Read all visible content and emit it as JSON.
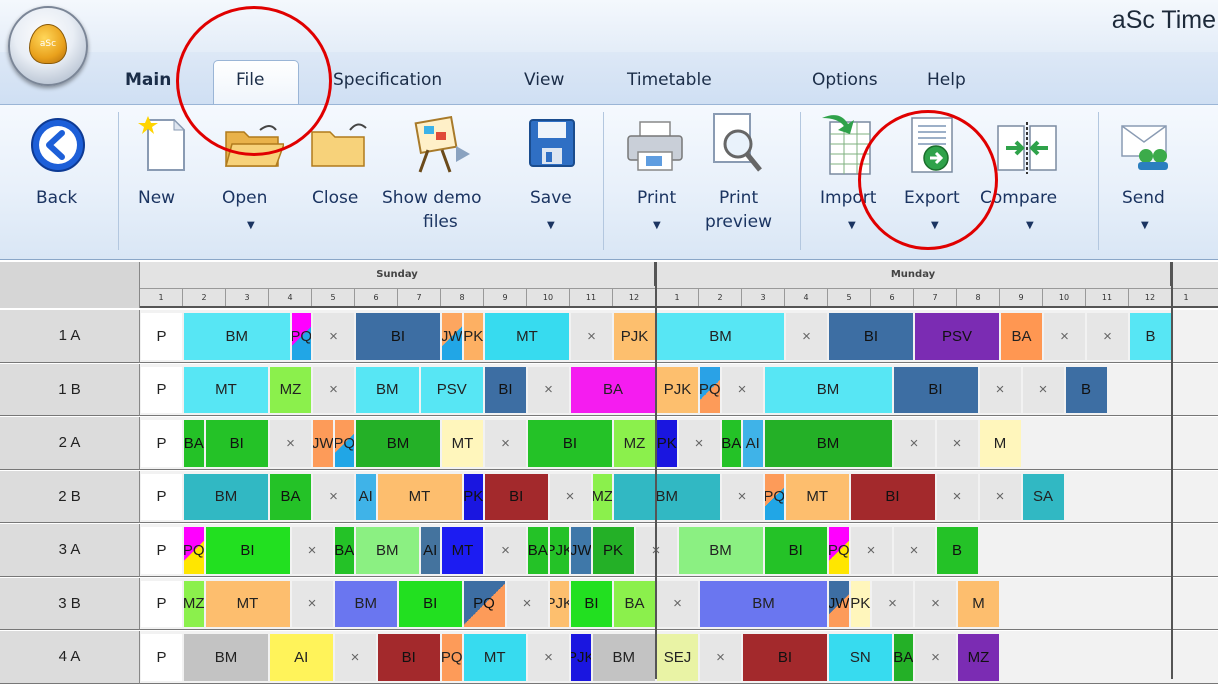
{
  "app": {
    "title": "aSc Time",
    "logo_text": "aSc"
  },
  "tabs": [
    "Main",
    "File",
    "Specification",
    "View",
    "Timetable",
    "Options",
    "Help"
  ],
  "ribbon": {
    "back": "Back",
    "new": "New",
    "open": "Open",
    "close": "Close",
    "show_demo_1": "Show demo",
    "show_demo_2": "files",
    "save": "Save",
    "print": "Print",
    "print_preview_1": "Print",
    "print_preview_2": "preview",
    "import": "Import",
    "export": "Export",
    "compare": "Compare",
    "send": "Send"
  },
  "timetable": {
    "days": [
      "Sunday",
      "Munday"
    ],
    "periods": [
      "1",
      "2",
      "3",
      "4",
      "5",
      "6",
      "7",
      "8",
      "9",
      "10",
      "11",
      "12"
    ],
    "classes": [
      "1 A",
      "1 B",
      "2 A",
      "2 B",
      "3 A",
      "3 B",
      "4 A"
    ],
    "free_mark": "×",
    "rows": [
      [
        [
          "P",
          "#ffffff",
          1
        ],
        [
          "BM",
          "#57e6f4",
          2.5
        ],
        [
          "PQ",
          "split:#ff00ff/#21a6e6",
          0.5
        ],
        [
          "×",
          "#e6e6e6",
          1
        ],
        [
          "BI",
          "#3d6ea3",
          2
        ],
        [
          "JW",
          "split:#fda660/#21a6e6",
          0.5
        ],
        [
          "PK",
          "#fdb063",
          0.5
        ],
        [
          "MT",
          "#37dbef",
          2
        ],
        [
          "×",
          "#e6e6e6",
          1
        ],
        [
          "PJK",
          "#fdbf6e",
          1
        ],
        [
          "BM",
          "#57e6f4",
          3
        ],
        [
          "×",
          "#e6e6e6",
          1
        ],
        [
          "BI",
          "#3d6ea3",
          2
        ],
        [
          "PSV",
          "#7b2cb3",
          2
        ],
        [
          "BA",
          "#ff9752",
          1
        ],
        [
          "×",
          "#e6e6e6",
          1
        ],
        [
          "×",
          "#e6e6e6",
          1
        ],
        [
          "B",
          "#57e6f4",
          1
        ]
      ],
      [
        [
          "P",
          "#ffffff",
          1
        ],
        [
          "MT",
          "#57e6f4",
          2
        ],
        [
          "MZ",
          "#8bf04c",
          1
        ],
        [
          "×",
          "#e6e6e6",
          1
        ],
        [
          "BM",
          "#57e6f4",
          1.5
        ],
        [
          "PSV",
          "#57e6f4",
          1.5
        ],
        [
          "BI",
          "#3d6ea3",
          1
        ],
        [
          "×",
          "#e6e6e6",
          1
        ],
        [
          "BA",
          "#f51cf0",
          2
        ],
        [
          "PJK",
          "#fdbf6e",
          1
        ],
        [
          "PQ",
          "split:#2aa2e6/#fd9b59",
          0.5
        ],
        [
          "×",
          "#e6e6e6",
          1
        ],
        [
          "BM",
          "#57e6f4",
          3
        ],
        [
          "BI",
          "#3d6ea3",
          2
        ],
        [
          "×",
          "#e6e6e6",
          1
        ],
        [
          "×",
          "#e6e6e6",
          1
        ],
        [
          "B",
          "#3d6ea3",
          1
        ]
      ],
      [
        [
          "P",
          "#ffffff",
          1
        ],
        [
          "BA",
          "#24c227",
          0.5
        ],
        [
          "BI",
          "#24c227",
          1.5
        ],
        [
          "×",
          "#e6e6e6",
          1
        ],
        [
          "JW",
          "#fd9b59",
          0.5
        ],
        [
          "PQ",
          "split:#fd9b59/#21a6e6",
          0.5
        ],
        [
          "BM",
          "#24b027",
          2
        ],
        [
          "MT",
          "#fff6bc",
          1
        ],
        [
          "×",
          "#e6e6e6",
          1
        ],
        [
          "BI",
          "#24c227",
          2
        ],
        [
          "MZ",
          "#8bf04c",
          1
        ],
        [
          "PK",
          "#1a16e0",
          0.5
        ],
        [
          "×",
          "#e6e6e6",
          1
        ],
        [
          "BA",
          "#24c227",
          0.5
        ],
        [
          "AI",
          "#3fb3e8",
          0.5
        ],
        [
          "BM",
          "#24b027",
          3
        ],
        [
          "×",
          "#e6e6e6",
          1
        ],
        [
          "×",
          "#e6e6e6",
          1
        ],
        [
          "M",
          "#fff6bc",
          1
        ]
      ],
      [
        [
          "P",
          "#ffffff",
          1
        ],
        [
          "BM",
          "#31b8c3",
          2
        ],
        [
          "BA",
          "#24c227",
          1
        ],
        [
          "×",
          "#e6e6e6",
          1
        ],
        [
          "AI",
          "#3fb3e8",
          0.5
        ],
        [
          "MT",
          "#fdbe6e",
          2
        ],
        [
          "PK",
          "#1a16e0",
          0.5
        ],
        [
          "BI",
          "#a3292c",
          1.5
        ],
        [
          "×",
          "#e6e6e6",
          1
        ],
        [
          "MZ",
          "#8bf04c",
          0.5
        ],
        [
          "BM",
          "#31b8c3",
          2.5
        ],
        [
          "×",
          "#e6e6e6",
          1
        ],
        [
          "PQ",
          "split:#fd9b59/#21a6e6",
          0.5
        ],
        [
          "MT",
          "#fdbe6e",
          1.5
        ],
        [
          "BI",
          "#a3292c",
          2
        ],
        [
          "×",
          "#e6e6e6",
          1
        ],
        [
          "×",
          "#e6e6e6",
          1
        ],
        [
          "SA",
          "#31b8c3",
          1
        ]
      ],
      [
        [
          "P",
          "#ffffff",
          1
        ],
        [
          "PQ",
          "split:#ff00ff/#ffe600",
          0.5
        ],
        [
          "BI",
          "#22e020",
          2
        ],
        [
          "×",
          "#e6e6e6",
          1
        ],
        [
          "BA",
          "#24c227",
          0.5
        ],
        [
          "BM",
          "#8bf082",
          1.5
        ],
        [
          "AI",
          "#44739e",
          0.5
        ],
        [
          "MT",
          "#1c1cf2",
          1
        ],
        [
          "×",
          "#e6e6e6",
          1
        ],
        [
          "BA",
          "#24c227",
          0.5
        ],
        [
          "PJK",
          "#24c227",
          0.5
        ],
        [
          "JW",
          "#3f78a9",
          0.5
        ],
        [
          "PK",
          "#24b027",
          1
        ],
        [
          "×",
          "#e6e6e6",
          1
        ],
        [
          "BM",
          "#8bf082",
          2
        ],
        [
          "BI",
          "#24c227",
          1.5
        ],
        [
          "PQ",
          "split:#ff00ff/#ffe600",
          0.5
        ],
        [
          "×",
          "#e6e6e6",
          1
        ],
        [
          "×",
          "#e6e6e6",
          1
        ],
        [
          "B",
          "#24c227",
          1
        ]
      ],
      [
        [
          "P",
          "#ffffff",
          1
        ],
        [
          "MZ",
          "#8bf04c",
          0.5
        ],
        [
          "MT",
          "#fdbe6e",
          2
        ],
        [
          "×",
          "#e6e6e6",
          1
        ],
        [
          "BM",
          "#6a76f0",
          1.5
        ],
        [
          "BI",
          "#22e020",
          1.5
        ],
        [
          "PQ",
          "split:#3d6ea3/#fd9b59",
          1
        ],
        [
          "×",
          "#e6e6e6",
          1
        ],
        [
          "PJK",
          "#fdbf6e",
          0.5
        ],
        [
          "BI",
          "#22e020",
          1
        ],
        [
          "BA",
          "#8bf04c",
          1
        ],
        [
          "×",
          "#e6e6e6",
          1
        ],
        [
          "BM",
          "#6a76f0",
          3
        ],
        [
          "JW",
          "split:#3d6ea3/#fd9b59",
          0.5
        ],
        [
          "PK",
          "#fff6bc",
          0.5
        ],
        [
          "×",
          "#e6e6e6",
          1
        ],
        [
          "×",
          "#e6e6e6",
          1
        ],
        [
          "M",
          "#fdbe6e",
          1
        ]
      ],
      [
        [
          "P",
          "#ffffff",
          1
        ],
        [
          "BM",
          "#c3c3c3",
          2
        ],
        [
          "AI",
          "#fff35a",
          1.5
        ],
        [
          "×",
          "#e6e6e6",
          1
        ],
        [
          "BI",
          "#a3292c",
          1.5
        ],
        [
          "PQ",
          "#fd9b59",
          0.5
        ],
        [
          "MT",
          "#37dbef",
          1.5
        ],
        [
          "×",
          "#e6e6e6",
          1
        ],
        [
          "PJK",
          "#1a16e0",
          0.5
        ],
        [
          "BM",
          "#c3c3c3",
          1.5
        ],
        [
          "SEJ",
          "#e9f3a5",
          1
        ],
        [
          "×",
          "#e6e6e6",
          1
        ],
        [
          "BI",
          "#a3292c",
          2
        ],
        [
          "SN",
          "#37dbef",
          1.5
        ],
        [
          "BA",
          "#24b027",
          0.5
        ],
        [
          "×",
          "#e6e6e6",
          1
        ],
        [
          "MZ",
          "#7b2cb3",
          1
        ]
      ]
    ]
  }
}
